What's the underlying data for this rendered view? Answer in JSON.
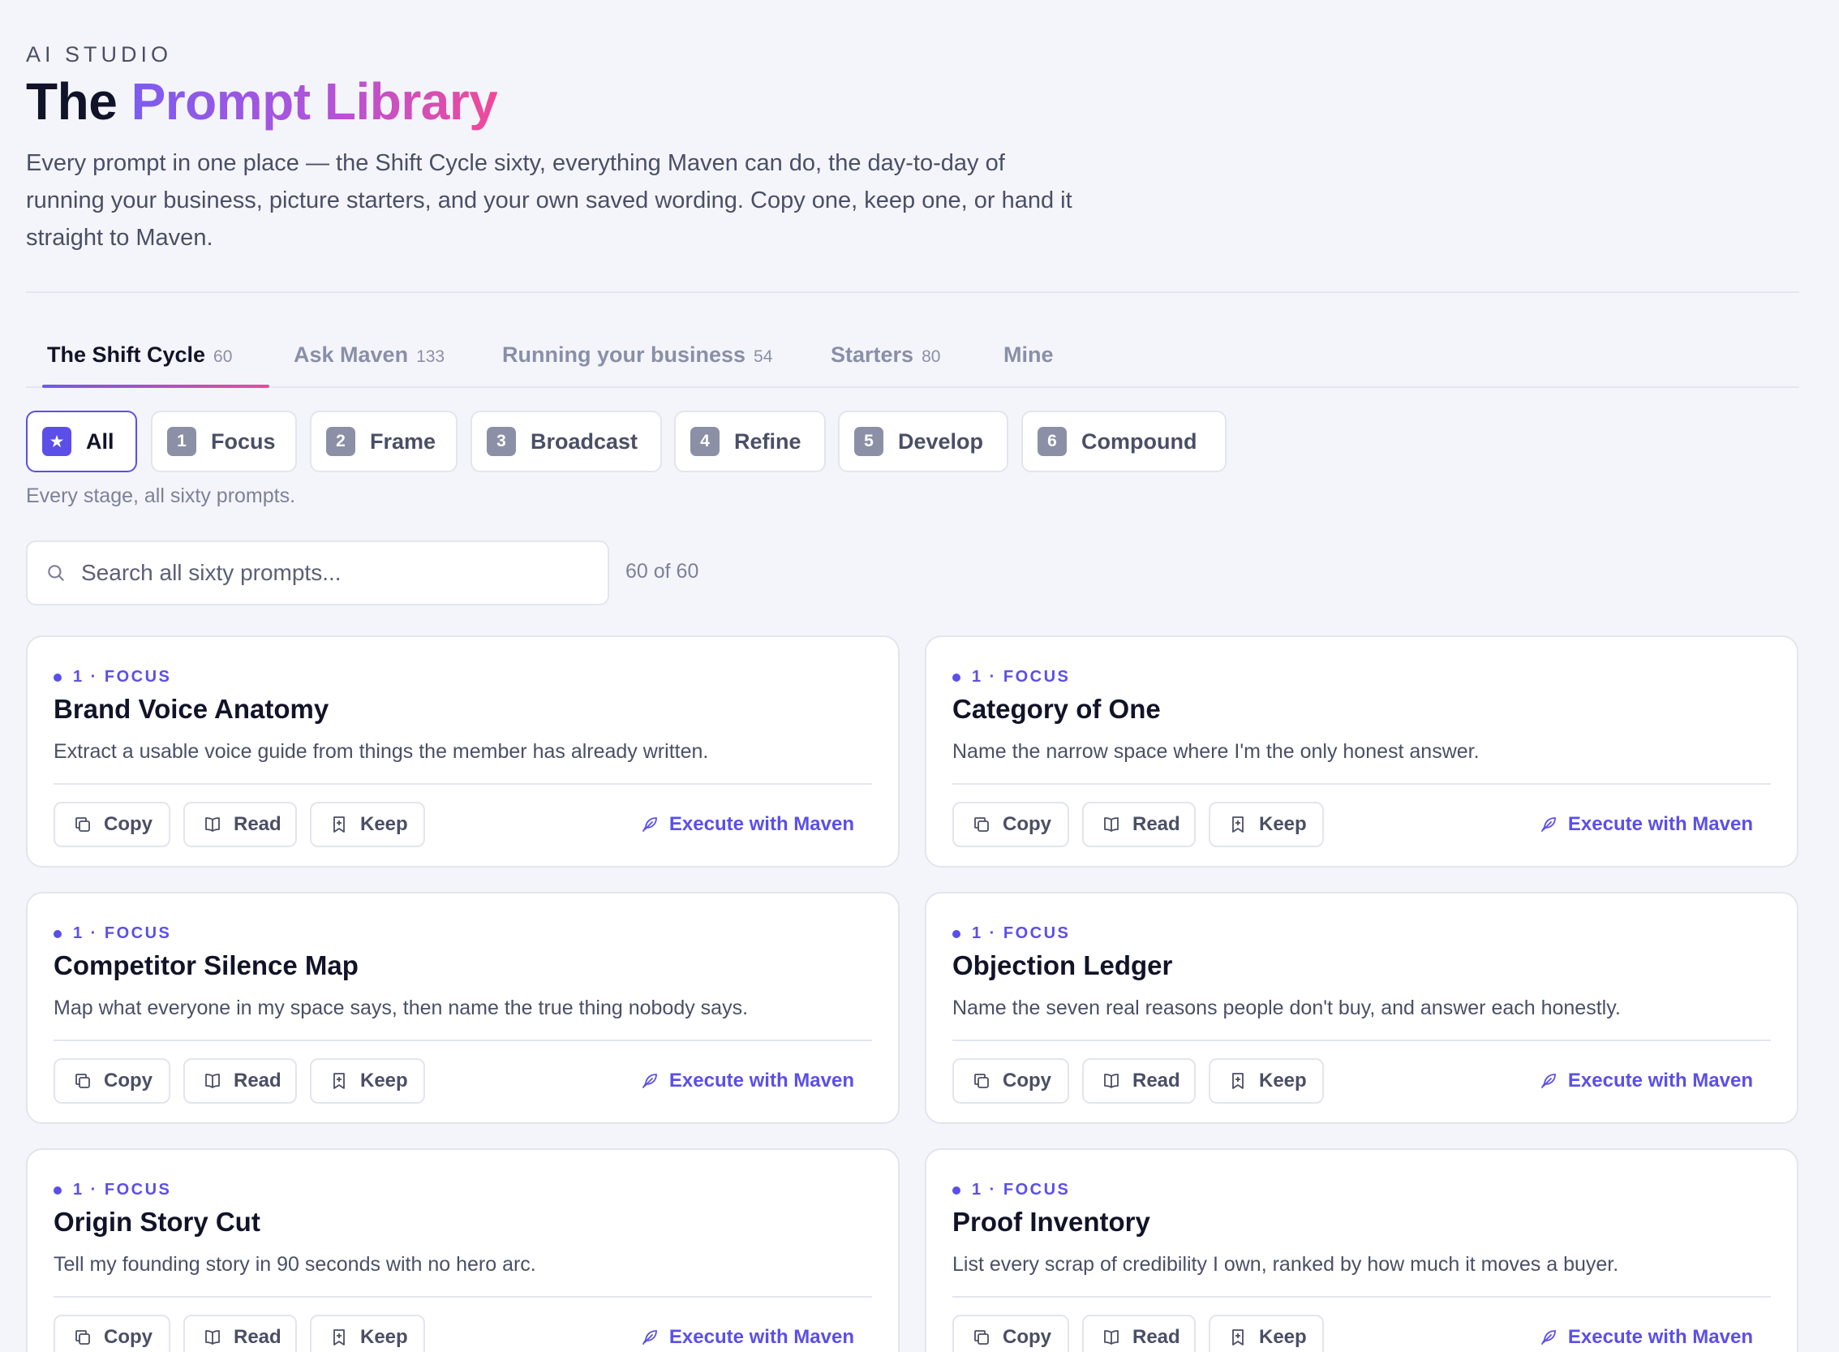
{
  "header": {
    "eyebrow": "AI STUDIO",
    "title_plain": "The",
    "title_accent": "Prompt Library",
    "lede": "Every prompt in one place — the Shift Cycle sixty, everything Maven can do, the day-to-day of running your business, picture starters, and your own saved wording. Copy one, keep one, or hand it straight to Maven."
  },
  "tabs": [
    {
      "label": "The Shift Cycle",
      "count": "60",
      "active": true
    },
    {
      "label": "Ask Maven",
      "count": "133",
      "active": false
    },
    {
      "label": "Running your business",
      "count": "54",
      "active": false
    },
    {
      "label": "Starters",
      "count": "80",
      "active": false
    },
    {
      "label": "Mine",
      "count": "",
      "active": false
    }
  ],
  "stages": [
    {
      "num": "★",
      "label": "All",
      "active": true
    },
    {
      "num": "1",
      "label": "Focus",
      "active": false
    },
    {
      "num": "2",
      "label": "Frame",
      "active": false
    },
    {
      "num": "3",
      "label": "Broadcast",
      "active": false
    },
    {
      "num": "4",
      "label": "Refine",
      "active": false
    },
    {
      "num": "5",
      "label": "Develop",
      "active": false
    },
    {
      "num": "6",
      "label": "Compound",
      "active": false
    }
  ],
  "stage_description": "Every stage, all sixty prompts.",
  "search": {
    "placeholder": "Search all sixty prompts...",
    "value": "",
    "result_count": "60 of 60"
  },
  "actions": {
    "copy": "Copy",
    "read": "Read",
    "keep": "Keep",
    "execute": "Execute with Maven"
  },
  "colors": {
    "accent": "#5b4fe8",
    "gradient_start": "#7c5cf0",
    "gradient_end": "#f04a98",
    "background": "#f4f5fa"
  },
  "cards": [
    {
      "tag": "1 · FOCUS",
      "title": "Brand Voice Anatomy",
      "desc": "Extract a usable voice guide from things the member has already written."
    },
    {
      "tag": "1 · FOCUS",
      "title": "Category of One",
      "desc": "Name the narrow space where I'm the only honest answer."
    },
    {
      "tag": "1 · FOCUS",
      "title": "Competitor Silence Map",
      "desc": "Map what everyone in my space says, then name the true thing nobody says."
    },
    {
      "tag": "1 · FOCUS",
      "title": "Objection Ledger",
      "desc": "Name the seven real reasons people don't buy, and answer each honestly."
    },
    {
      "tag": "1 · FOCUS",
      "title": "Origin Story Cut",
      "desc": "Tell my founding story in 90 seconds with no hero arc."
    },
    {
      "tag": "1 · FOCUS",
      "title": "Proof Inventory",
      "desc": "List every scrap of credibility I own, ranked by how much it moves a buyer."
    }
  ]
}
